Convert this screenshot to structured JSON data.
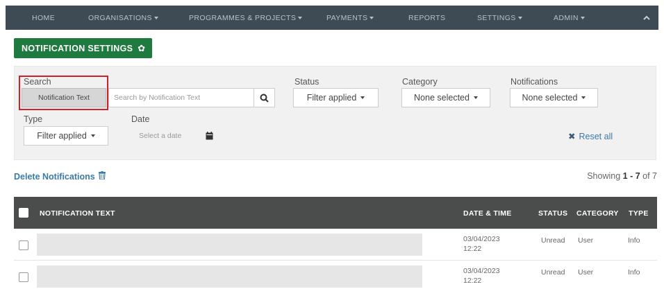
{
  "nav": {
    "items": [
      {
        "label": "HOME",
        "dropdown": false
      },
      {
        "label": "ORGANISATIONS",
        "dropdown": true
      },
      {
        "label": "PROGRAMMES & PROJECTS",
        "dropdown": true
      },
      {
        "label": "PAYMENTS",
        "dropdown": true
      },
      {
        "label": "REPORTS",
        "dropdown": false
      },
      {
        "label": "SETTINGS",
        "dropdown": true
      },
      {
        "label": "ADMIN",
        "dropdown": true
      }
    ],
    "collapse_icon": "chevron-up-icon",
    "bg_color": "#3e4a54"
  },
  "header": {
    "button_label": "NOTIFICATION SETTINGS",
    "button_icon": "gear-icon",
    "button_color": "#1f7a3f"
  },
  "filters": {
    "search_label": "Search",
    "search_type": "Notification Text",
    "search_placeholder": "Search by Notification Text",
    "status_label": "Status",
    "status_value": "Filter applied",
    "category_label": "Category",
    "category_value": "None selected",
    "notifications_label": "Notifications",
    "notifications_value": "None selected",
    "type_label": "Type",
    "type_value": "Filter applied",
    "date_label": "Date",
    "date_placeholder": "Select a date",
    "reset_label": "Reset all",
    "highlight_color": "#d0202a"
  },
  "actions": {
    "delete_label": "Delete Notifications",
    "showing_prefix": "Showing",
    "showing_range": "1 - 7",
    "showing_of": "of 7"
  },
  "table": {
    "headers": {
      "text": "NOTIFICATION TEXT",
      "datetime": "DATE & TIME",
      "status": "STATUS",
      "category": "CATEGORY",
      "type": "TYPE"
    },
    "rows": [
      {
        "date": "03/04/2023",
        "time": "12:22",
        "status": "Unread",
        "category": "User",
        "type": "Info"
      },
      {
        "date": "03/04/2023",
        "time": "12:22",
        "status": "Unread",
        "category": "User",
        "type": "Info"
      }
    ]
  }
}
